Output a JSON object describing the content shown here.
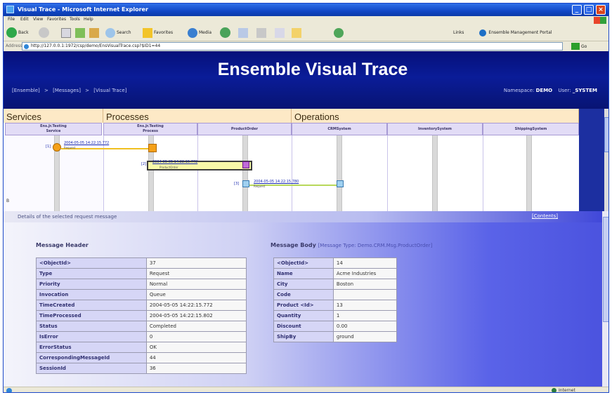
{
  "window": {
    "title": "Visual Trace - Microsoft Internet Explorer",
    "menu": [
      "File",
      "Edit",
      "View",
      "Favorites",
      "Tools",
      "Help"
    ],
    "toolbar": {
      "back": "Back",
      "search": "Search",
      "favorites": "Favorites",
      "media": "Media",
      "links_label": "Links",
      "links_item": "Ensemble Management Portal"
    },
    "address": {
      "label": "Address",
      "value": "http://127.0.0.1:1972/csp/demo/EnsVisualTrace.csp?$ID1=44",
      "go": "Go"
    },
    "status": {
      "zone": "Internet"
    }
  },
  "banner": {
    "title": "Ensemble Visual Trace",
    "breadcrumb": [
      "[Ensemble]",
      ">",
      "[Messages]",
      ">",
      "[Visual Trace]"
    ],
    "namespace_label": "Namespace:",
    "namespace": "DEMO",
    "user_label": "User:",
    "user": "_SYSTEM"
  },
  "trace": {
    "sections": [
      {
        "label": "Services"
      },
      {
        "label": "Processes"
      },
      {
        "label": "Operations"
      }
    ],
    "columns": [
      {
        "line1": "Ens.Jr.Testing",
        "line2": "Service"
      },
      {
        "line1": "Ens.Jr.Testing",
        "line2": "Process"
      },
      {
        "line1": "ProductOrder",
        "line2": ""
      },
      {
        "line1": "CRMSystem",
        "line2": ""
      },
      {
        "line1": "InventorySystem",
        "line2": ""
      },
      {
        "line1": "ShippingSystem",
        "line2": ""
      }
    ],
    "messages": [
      {
        "num": "[1]",
        "time": "2004-05-05 14:22:15.772",
        "type": "Request"
      },
      {
        "num": "[2]",
        "time": "2004-05-05 14:22:15.772",
        "type": "ProductOrder"
      },
      {
        "num": "[3]",
        "time": "2004-05-05 14:22:15.780",
        "type": "Request"
      }
    ],
    "side_marker": "B"
  },
  "details": {
    "title": "Details of the selected request message",
    "link": "[Contents]",
    "header_label": "Message Header",
    "body_label": "Message Body",
    "body_note": "[Message Type: Demo.CRM.Msg.ProductOrder]",
    "header_rows": [
      {
        "key": "<ObjectId>",
        "value": "37"
      },
      {
        "key": "Type",
        "value": "Request"
      },
      {
        "key": "Priority",
        "value": "Normal"
      },
      {
        "key": "Invocation",
        "value": "Queue"
      },
      {
        "key": "TimeCreated",
        "value": "2004-05-05 14:22:15.772"
      },
      {
        "key": "TimeProcessed",
        "value": "2004-05-05 14:22:15.802"
      },
      {
        "key": "Status",
        "value": "Completed"
      },
      {
        "key": "IsError",
        "value": "0"
      },
      {
        "key": "ErrorStatus",
        "value": "OK"
      },
      {
        "key": "CorrespondingMessageId",
        "value": "44"
      },
      {
        "key": "SessionId",
        "value": "36"
      }
    ],
    "body_rows": [
      {
        "key": "<ObjectId>",
        "value": "14"
      },
      {
        "key": "Name",
        "value": "Acme Industries"
      },
      {
        "key": "City",
        "value": "Boston"
      },
      {
        "key": "Code",
        "value": ""
      },
      {
        "key": "Product <Id>",
        "value": "13"
      },
      {
        "key": "Quantity",
        "value": "1"
      },
      {
        "key": "Discount",
        "value": "0.00"
      },
      {
        "key": "ShipBy",
        "value": "ground"
      }
    ]
  },
  "colors": {
    "banner": "#0a1c98",
    "section_header": "#fde9c6",
    "column_header": "#e2dcf6",
    "table_key": "#d6d6f6",
    "message_arrow": "#f0c020"
  }
}
